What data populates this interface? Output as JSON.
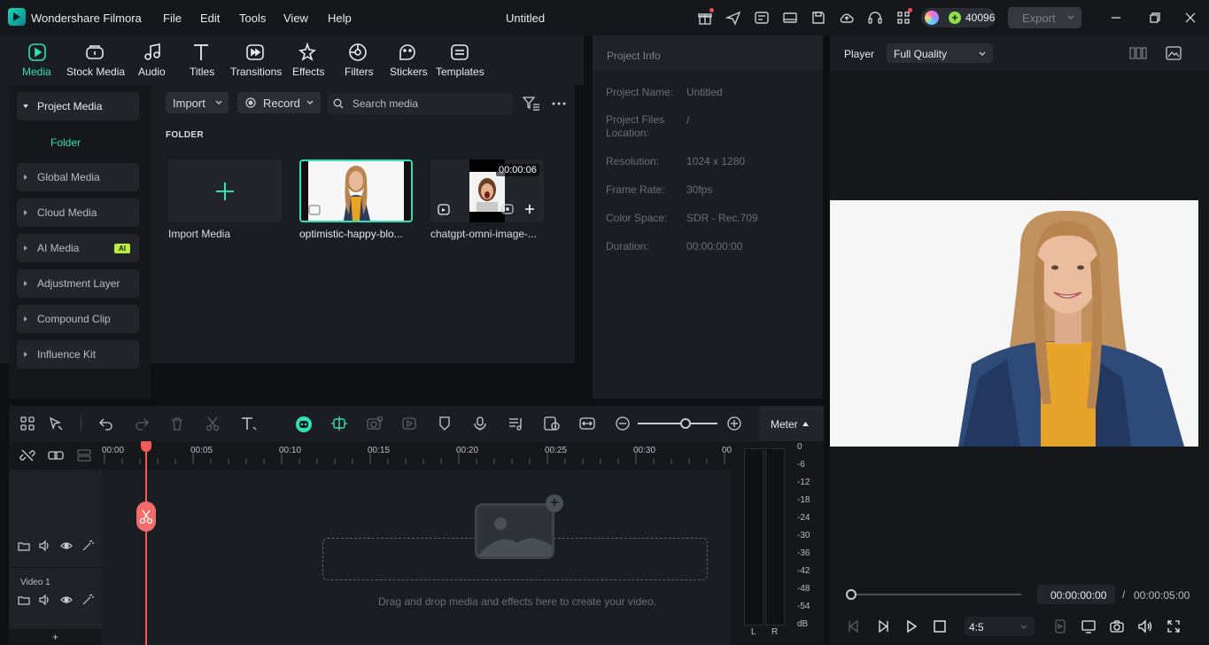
{
  "app": {
    "name": "Wondershare Filmora",
    "document_title": "Untitled",
    "menu": [
      "File",
      "Edit",
      "Tools",
      "View",
      "Help"
    ],
    "credits": "40096",
    "export_label": "Export",
    "brand_color": "#1ad6b5",
    "accent_color": "#2fe0b4"
  },
  "media_tabs": [
    {
      "label": "Media",
      "icon": "media-icon",
      "active": true
    },
    {
      "label": "Stock Media",
      "icon": "stock-media-icon"
    },
    {
      "label": "Audio",
      "icon": "audio-icon"
    },
    {
      "label": "Titles",
      "icon": "titles-icon"
    },
    {
      "label": "Transitions",
      "icon": "transitions-icon"
    },
    {
      "label": "Effects",
      "icon": "effects-icon"
    },
    {
      "label": "Filters",
      "icon": "filters-icon"
    },
    {
      "label": "Stickers",
      "icon": "stickers-icon"
    },
    {
      "label": "Templates",
      "icon": "templates-icon"
    }
  ],
  "left_nav": {
    "items": [
      {
        "label": "Project Media",
        "expanded": true
      },
      {
        "label": "Global Media"
      },
      {
        "label": "Cloud Media"
      },
      {
        "label": "AI Media",
        "badge": "AI"
      },
      {
        "label": "Adjustment Layer"
      },
      {
        "label": "Compound Clip"
      },
      {
        "label": "Influence Kit"
      }
    ],
    "sub_folder": "Folder"
  },
  "media_toolbar": {
    "import_label": "Import",
    "record_label": "Record",
    "search_placeholder": "Search media"
  },
  "folder_section": "FOLDER",
  "media_items": [
    {
      "label": "Import Media"
    },
    {
      "label": "optimistic-happy-blo...",
      "selected": true
    },
    {
      "label": "chatgpt-omni-image-...",
      "duration": "00:00:06"
    }
  ],
  "project_info": {
    "title": "Project Info",
    "rows": [
      {
        "key": "Project Name:",
        "value": "Untitled"
      },
      {
        "key": "Project Files Location:",
        "value": "/"
      },
      {
        "key": "Resolution:",
        "value": "1024 x 1280"
      },
      {
        "key": "Frame Rate:",
        "value": "30fps"
      },
      {
        "key": "Color Space:",
        "value": "SDR - Rec.709"
      },
      {
        "key": "Duration:",
        "value": "00:00:00:00"
      }
    ]
  },
  "player": {
    "label": "Player",
    "quality": "Full Quality",
    "current_time": "00:00:00:00",
    "separator": "/",
    "total_time": "00:00:05:00",
    "aspect_ratio": "4:5",
    "progress": 0
  },
  "timeline": {
    "meter_label": "Meter",
    "ruler_ticks": [
      "00:00",
      "00:05",
      "00:10",
      "00:15",
      "00:20",
      "00:25",
      "00:30",
      "00"
    ],
    "track_name": "Video 1",
    "drop_hint": "Drag and drop media and effects here to create your video.",
    "add_track": "+",
    "zoom_level": 0.6,
    "meter_db": [
      "0",
      "-6",
      "-12",
      "-18",
      "-24",
      "-30",
      "-36",
      "-42",
      "-48",
      "-54",
      "dB"
    ],
    "meter_channels": [
      "L",
      "R"
    ],
    "playhead_color": "#f35b5b"
  }
}
